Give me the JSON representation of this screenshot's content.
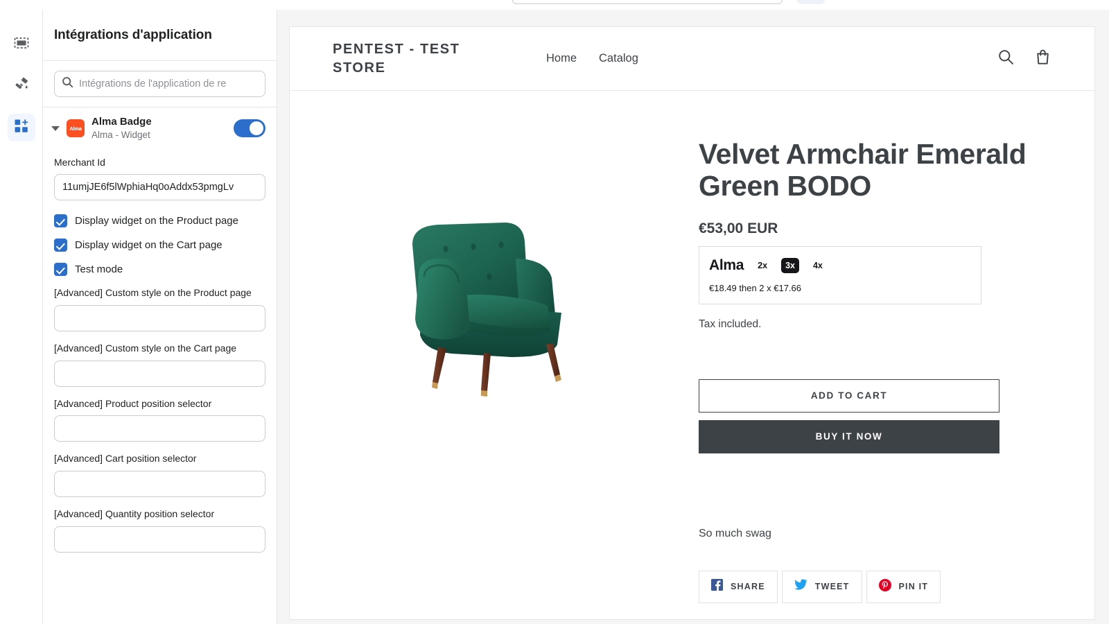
{
  "top_strip": {
    "url_bar_present": true,
    "right_button_present": true
  },
  "icon_rail": {
    "items": [
      {
        "name": "sections-icon",
        "label": "Sections",
        "selected": false
      },
      {
        "name": "theme-settings-icon",
        "label": "Theme settings",
        "selected": false
      },
      {
        "name": "app-embeds-icon",
        "label": "App embeds",
        "selected": true
      }
    ]
  },
  "settings_panel": {
    "header_title": "Intégrations d'application",
    "search": {
      "placeholder": "Intégrations de l'application de re",
      "value": "",
      "icon": "search-icon"
    },
    "app_block": {
      "caret_icon": "chevron-down-icon",
      "app_icon_label": "Alma",
      "title": "Alma Badge",
      "subtitle": "Alma - Widget",
      "toggle_on": true
    },
    "fields": [
      {
        "label": "Merchant Id",
        "value": "11umjJE6f5lWphiaHq0oAddx53pmgLv",
        "placeholder": ""
      },
      {
        "label": "[Advanced] Custom style on the Product page",
        "value": "",
        "placeholder": ""
      },
      {
        "label": "[Advanced] Custom style on the Cart page",
        "value": "",
        "placeholder": ""
      },
      {
        "label": "[Advanced] Product position selector",
        "value": "",
        "placeholder": ""
      },
      {
        "label": "[Advanced] Cart position selector",
        "value": "",
        "placeholder": ""
      },
      {
        "label": "[Advanced] Quantity position selector",
        "value": "",
        "placeholder": ""
      }
    ],
    "checkboxes": [
      {
        "label": "Display widget on the Product page",
        "checked": true
      },
      {
        "label": "Display widget on the Cart page",
        "checked": true
      },
      {
        "label": "Test mode",
        "checked": true
      }
    ]
  },
  "storefront": {
    "logo": "PENTEST - TEST STORE",
    "nav": [
      {
        "label": "Home"
      },
      {
        "label": "Catalog"
      }
    ],
    "header_icons": [
      {
        "name": "search-icon",
        "label": "Search"
      },
      {
        "name": "cart-icon",
        "label": "Cart"
      }
    ],
    "product": {
      "image_alt": "Velvet armchair in emerald green with wooden legs",
      "title": "Velvet Armchair Emerald Green BODO",
      "price": "€53,00 EUR",
      "tax_note": "Tax included.",
      "description": "So much swag",
      "alma_widget": {
        "brand": "Alma",
        "plans": [
          {
            "label": "2x",
            "active": false
          },
          {
            "label": "3x",
            "active": true
          },
          {
            "label": "4x",
            "active": false
          }
        ],
        "detail": "€18.49 then 2 x €17.66"
      },
      "buttons": {
        "add_to_cart": "ADD TO CART",
        "buy_it_now": "BUY IT NOW"
      },
      "share_buttons": [
        {
          "label": "SHARE",
          "icon": "facebook-icon",
          "color": "#3b5998"
        },
        {
          "label": "TWEET",
          "icon": "twitter-icon",
          "color": "#1da1f2"
        },
        {
          "label": "PIN IT",
          "icon": "pinterest-icon",
          "color": "#e60023"
        }
      ]
    }
  },
  "colors": {
    "accent_blue": "#2c6ecb",
    "alma_orange": "#fa5022",
    "store_dark": "#3d4246",
    "chair_green": "#1c5c4a"
  }
}
